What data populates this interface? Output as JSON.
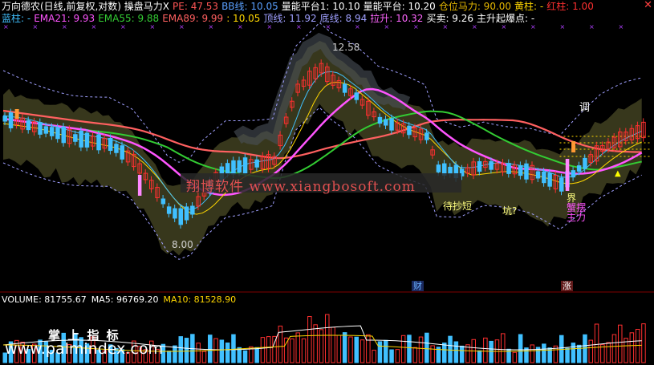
{
  "header": {
    "line1": [
      {
        "text": "万向德农(日线,前复权,对数) 操盘马力X",
        "color": "#ffffff"
      },
      {
        "text": "PE: 47.53",
        "color": "#ff5555"
      },
      {
        "text": "BB线: 10.05",
        "color": "#5aa0ff"
      },
      {
        "text": "量能平台1: 10.10",
        "color": "#ffffff"
      },
      {
        "text": "量能平台: 10.20",
        "color": "#ffffff"
      },
      {
        "text": "仓位马力: 90.00",
        "color": "#e6b800"
      },
      {
        "text": "黄柱: -",
        "color": "#ffd700"
      },
      {
        "text": "红柱: 1.00",
        "color": "#ff3030"
      }
    ],
    "line2": [
      {
        "text": "蓝柱: -",
        "color": "#40c0ff"
      },
      {
        "text": "EMA21: 9.93",
        "color": "#ff55ff"
      },
      {
        "text": "EMA55: 9.88",
        "color": "#33cc33"
      },
      {
        "text": "EMA89: 9.99",
        "color": "#ff6060"
      },
      {
        "text": ": 10.05",
        "color": "#ffd700"
      },
      {
        "text": "顶线: 11.92",
        "color": "#a0a0ff"
      },
      {
        "text": "底线: 8.94",
        "color": "#a0a0ff"
      },
      {
        "text": "拉升: 10.32",
        "color": "#ff66ff"
      },
      {
        "text": "买卖: 9.26",
        "color": "#ffffff"
      },
      {
        "text": "主升起爆点: -",
        "color": "#ffffff"
      }
    ],
    "close_glyph": "✕"
  },
  "annotations": {
    "high_label": "12.58",
    "low_label": "8.00",
    "wait_short": "待抄短",
    "pit": "坑?",
    "tiao": "调",
    "jie": "界",
    "yinlian": "蟹摆",
    "zhuli": "主力",
    "marker_cai": "财",
    "marker_zhang": "涨",
    "triangle": "▲"
  },
  "volume": {
    "items": [
      {
        "text": "VOLUME: 81755.67",
        "color": "#ffffff"
      },
      {
        "text": "MA5: 96769.20",
        "color": "#ffffff"
      },
      {
        "text": "MA10: 81528.90",
        "color": "#ffd700"
      }
    ]
  },
  "watermarks": {
    "center": "翔博软件 www.xiangbosoft.com",
    "bottom_title": "掌 上 指 标",
    "bottom_url": "www.palmindex.com"
  },
  "colors": {
    "up": "#ff3030",
    "down": "#40c0ff",
    "band": "#3a3a1e",
    "band_gray": "#4a5058",
    "ema21": "#ff55ff",
    "ema55": "#33cc33",
    "ema89": "#ff6060",
    "yellow": "#ffd700"
  }
}
